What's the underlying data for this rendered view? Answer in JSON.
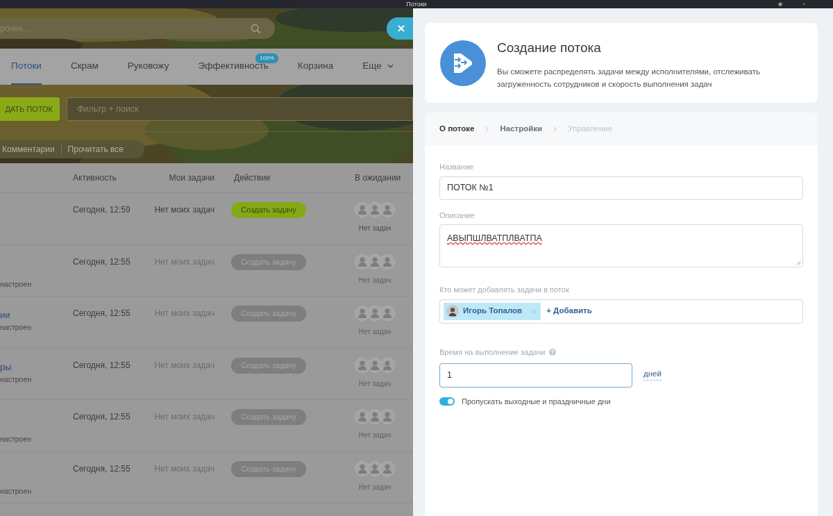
{
  "window": {
    "title": "Потоки"
  },
  "search": {
    "placeholder": "рочее..."
  },
  "nav_tabs": [
    {
      "label": "Потоки",
      "selected": true,
      "kind": "tab"
    },
    {
      "label": "Скрам",
      "selected": false,
      "kind": "tab"
    },
    {
      "label": "Руковожу",
      "selected": false,
      "kind": "tab"
    },
    {
      "label": "Эффективность",
      "selected": false,
      "kind": "tab",
      "badge": "100%"
    },
    {
      "label": "Корзина",
      "selected": false,
      "kind": "tab"
    },
    {
      "label": "Еще",
      "selected": false,
      "kind": "dropdown"
    }
  ],
  "toolbar": {
    "create_button": "ДАТЬ ПОТОК",
    "filter": {
      "placeholder": "Фильтр + поиск"
    },
    "links": [
      "Комментарии",
      "Прочитать все"
    ]
  },
  "table": {
    "columns": [
      "Активность",
      "Мои задачи",
      "Действие",
      "В ожидании"
    ],
    "rows": [
      {
        "activity": "Сегодня, 12:59",
        "my_tasks": "Нет моих задач",
        "action": "Создать задачу",
        "enabled": true,
        "waiting": "Нет задач"
      },
      {
        "subtitle": "настроен",
        "activity": "Сегодня, 12:55",
        "my_tasks": "Нет моих задач",
        "action": "Создать задачу",
        "enabled": false,
        "waiting": "Нет задач"
      },
      {
        "name": "ии",
        "subtitle": "настроен",
        "activity": "Сегодня, 12:55",
        "my_tasks": "Нет моих задач",
        "action": "Создать задачу",
        "enabled": false,
        "waiting": "Нет задач"
      },
      {
        "name": "ры",
        "subtitle": "настроен",
        "activity": "Сегодня, 12:55",
        "my_tasks": "Нет моих задач",
        "action": "Создать задачу",
        "enabled": false,
        "waiting": "Нет задач"
      },
      {
        "subtitle": "настроен",
        "activity": "Сегодня, 12:55",
        "my_tasks": "Нет моих задач",
        "action": "Создать задачу",
        "enabled": false,
        "waiting": "Нет задач"
      },
      {
        "subtitle": "настроен",
        "activity": "Сегодня, 12:55",
        "my_tasks": "Нет моих задач",
        "action": "Создать задачу",
        "enabled": false,
        "waiting": "Нет задач"
      }
    ]
  },
  "panel": {
    "title": "Создание потока",
    "description": "Вы сможете распределять задачи между исполнителями, отслеживать загруженность сотрудников и скорость выполнения задач",
    "steps": [
      {
        "label": "О потоке",
        "selected": true,
        "disabled": false
      },
      {
        "label": "Настройки",
        "selected": false,
        "disabled": false
      },
      {
        "label": "Управление",
        "selected": false,
        "disabled": true
      }
    ],
    "name_field": {
      "label": "Название",
      "value": "ПОТОК №1"
    },
    "description_field": {
      "label": "Описание",
      "value": "АВЫПШЛВАТПЛВАТПА"
    },
    "members_field": {
      "label": "Кто может добавлять задачи в поток",
      "tags": [
        {
          "name": "Игорь Топалов"
        }
      ],
      "add_link": "+ Добавить"
    },
    "duration_field": {
      "label": "Время на выполнение задачи",
      "value": "1",
      "unit": "дней"
    },
    "skip_holidays": {
      "label": "Пропускать выходные и праздничные дни",
      "on": true
    }
  }
}
